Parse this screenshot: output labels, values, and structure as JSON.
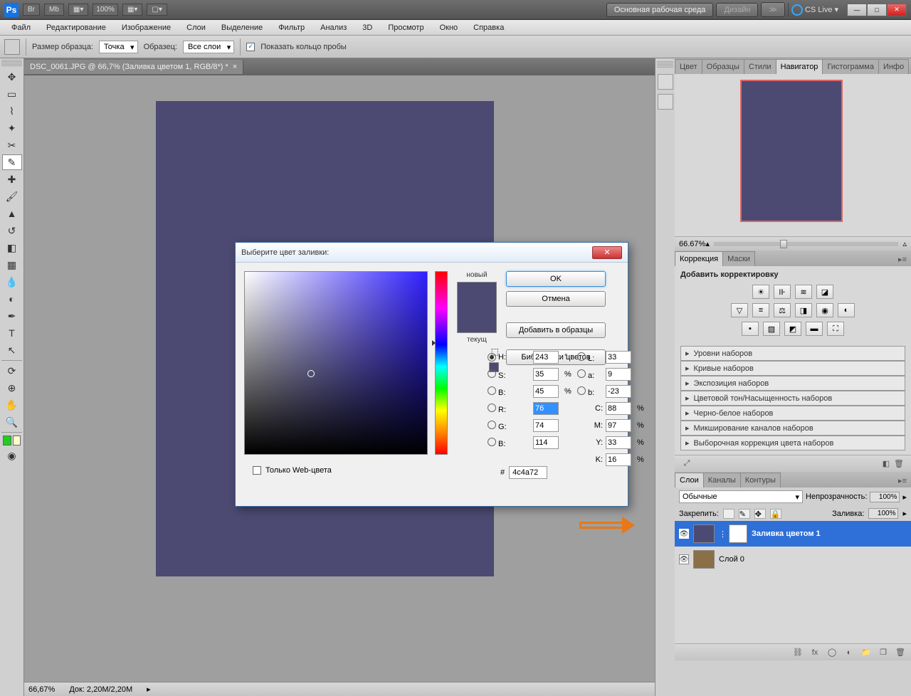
{
  "top": {
    "zoom": "100%",
    "workspace": "Основная рабочая среда",
    "design": "Дизайн",
    "cslive": "CS Live"
  },
  "menu": [
    "Файл",
    "Редактирование",
    "Изображение",
    "Слои",
    "Выделение",
    "Фильтр",
    "Анализ",
    "3D",
    "Просмотр",
    "Окно",
    "Справка"
  ],
  "opt": {
    "sizeLabel": "Размер образца:",
    "sizeVal": "Точка",
    "sampleLabel": "Образец:",
    "sampleVal": "Все слои",
    "ring": "Показать кольцо пробы"
  },
  "doc": {
    "tab": "DSC_0061.JPG @ 66,7% (Заливка цветом 1, RGB/8*) *",
    "botZoom": "66,67%",
    "botDoc": "Док: 2,20M/2,20M"
  },
  "nav": {
    "tabs": [
      "Цвет",
      "Образцы",
      "Стили",
      "Навигатор",
      "Гистограмма",
      "Инфо"
    ],
    "zoom": "66.67%"
  },
  "corr": {
    "tabs": [
      "Коррекция",
      "Маски"
    ],
    "title": "Добавить корректировку",
    "presets": [
      "Уровни наборов",
      "Кривые наборов",
      "Экспозиция наборов",
      "Цветовой тон/Насыщенность наборов",
      "Черно-белое наборов",
      "Микширование каналов наборов",
      "Выборочная коррекция цвета наборов"
    ]
  },
  "layers": {
    "tabs": [
      "Слои",
      "Каналы",
      "Контуры"
    ],
    "blend": "Обычные",
    "opLabel": "Непрозрачность:",
    "opVal": "100%",
    "lockLabel": "Закрепить:",
    "fillLabel": "Заливка:",
    "fillVal": "100%",
    "l1": "Заливка цветом 1",
    "l2": "Слой 0"
  },
  "dlg": {
    "title": "Выберите цвет заливки:",
    "ok": "OK",
    "cancel": "Отмена",
    "addSwatch": "Добавить в образцы",
    "libs": "Библиотеки цветов",
    "new": "новый",
    "cur": "текущ",
    "web": "Только Web-цвета",
    "H": "H:",
    "Hv": "243",
    "Hd": "°",
    "S": "S:",
    "Sv": "35",
    "Sd": "%",
    "B": "B:",
    "Bv": "45",
    "Bd": "%",
    "R": "R:",
    "Rv": "76",
    "G": "G:",
    "Gv": "74",
    "Bch": "B:",
    "Bchv": "114",
    "L": "L:",
    "Lv": "33",
    "a": "a:",
    "av": "9",
    "bl": "b:",
    "blv": "-23",
    "C": "C:",
    "Cv": "88",
    "M": "M:",
    "Mv": "97",
    "Y": "Y:",
    "Yv": "33",
    "K": "K:",
    "Kv": "16",
    "pct": "%",
    "hash": "#",
    "hex": "4c4a72"
  }
}
